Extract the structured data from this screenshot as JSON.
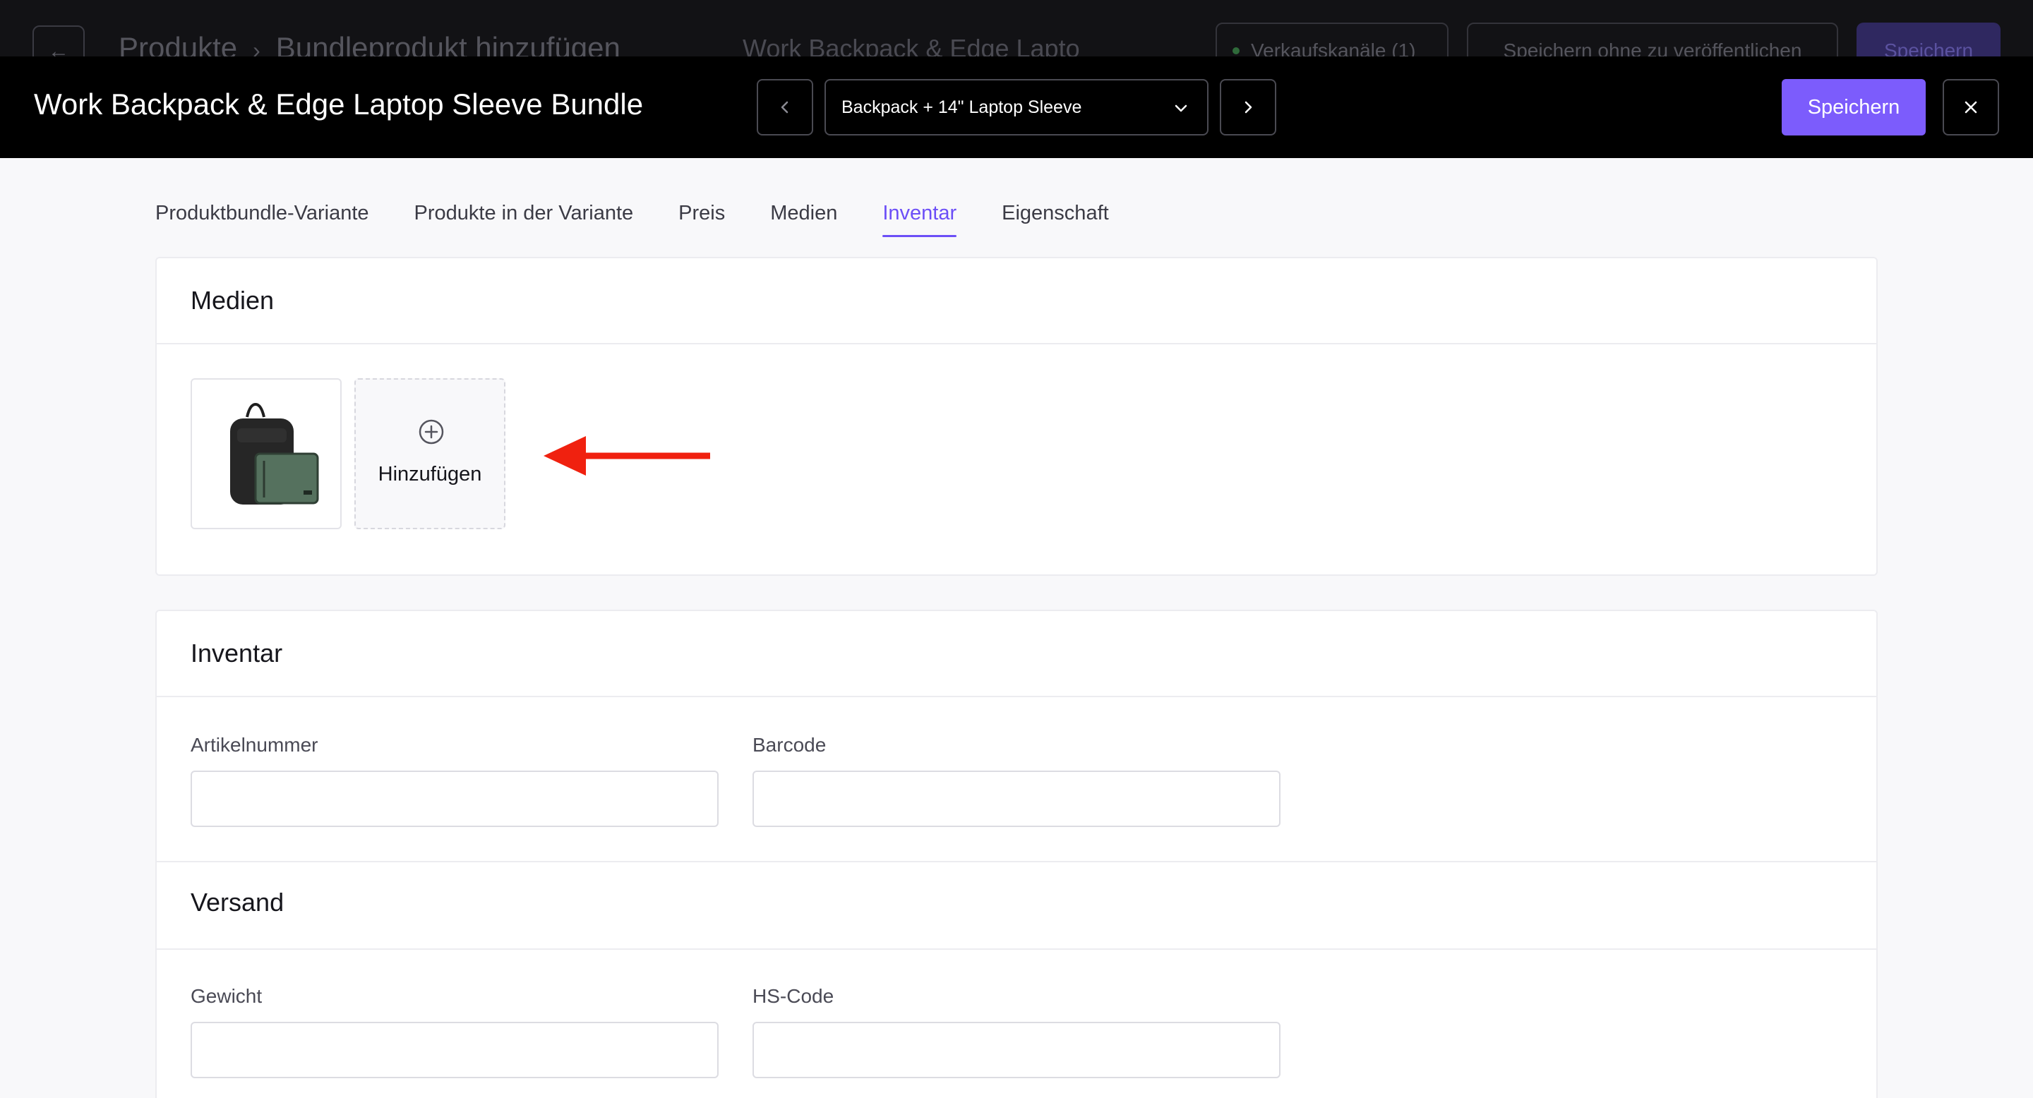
{
  "background": {
    "breadcrumb": [
      "Produkte",
      "Bundleprodukt hinzufügen"
    ],
    "title": "Work Backpack & Edge Lapto",
    "channels_label": "Verkaufskanäle (1)",
    "save_draft_label": "Speichern ohne zu veröffentlichen",
    "save_label": "Speichern"
  },
  "modal": {
    "title": "Work Backpack & Edge Laptop Sleeve Bundle",
    "variant_selected": "Backpack + 14\" Laptop Sleeve",
    "save_label": "Speichern"
  },
  "tabs": [
    {
      "label": "Produktbundle-Variante",
      "active": false
    },
    {
      "label": "Produkte in der Variante",
      "active": false
    },
    {
      "label": "Preis",
      "active": false
    },
    {
      "label": "Medien",
      "active": false
    },
    {
      "label": "Inventar",
      "active": true
    },
    {
      "label": "Eigenschaft",
      "active": false
    }
  ],
  "media": {
    "heading": "Medien",
    "add_label": "Hinzufügen"
  },
  "inventory": {
    "heading": "Inventar",
    "sku_label": "Artikelnummer",
    "sku_value": "",
    "barcode_label": "Barcode",
    "barcode_value": ""
  },
  "shipping": {
    "heading": "Versand",
    "weight_label": "Gewicht",
    "weight_value": "",
    "hs_label": "HS-Code",
    "hs_value": ""
  },
  "colors": {
    "accent": "#7c5cfc",
    "annotation_arrow": "#f0210f"
  }
}
